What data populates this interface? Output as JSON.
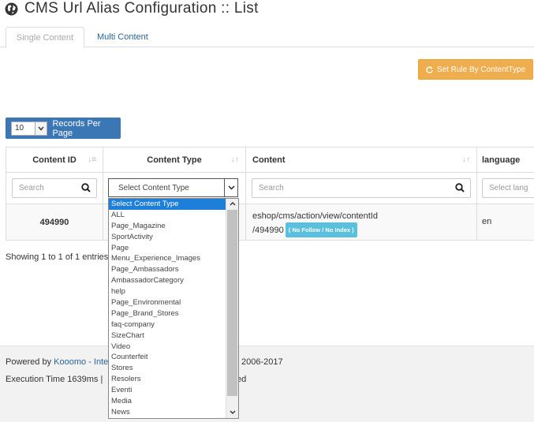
{
  "page": {
    "title": "CMS Url Alias Configuration :: List"
  },
  "tabs": [
    {
      "label": "Single Content",
      "active": true
    },
    {
      "label": "Multi Content",
      "active": false
    }
  ],
  "toolbar": {
    "rule_button_label": "Set Rule By ContentType"
  },
  "records_per_page": {
    "value": "10",
    "label": "Records Per Page"
  },
  "table": {
    "columns": [
      {
        "label": "Content ID"
      },
      {
        "label": "Content Type"
      },
      {
        "label": "Content"
      },
      {
        "label": "language"
      }
    ],
    "filters": {
      "content_id_placeholder": "Search",
      "content_type_value": "Select Content Type",
      "content_placeholder": "Search",
      "language_placeholder": "Select lang"
    },
    "rows": [
      {
        "content_id": "494990",
        "content_line1": "eshop/cms/action/view/contentId",
        "content_line2": "/494990",
        "badge": "( No Follow / No Index )",
        "language": "en"
      }
    ]
  },
  "info": {
    "text": "Showing 1 to 1 of 1 entries"
  },
  "content_type_dropdown": {
    "options": [
      "Select Content Type",
      "ALL",
      "Page_Magazine",
      "SportActivity",
      "Page",
      "Menu_Experience_Images",
      "Page_Ambassadors",
      "AmbassadorCategory",
      "help",
      "Page_Environmental",
      "Page_Brand_Stores",
      "faq-company",
      "SizeChart",
      "Video",
      "Counterfeit",
      "Stores",
      "Resolers",
      "Eventi",
      "Media",
      "News"
    ],
    "selected_index": 0
  },
  "footer": {
    "powered_prefix": "Powered by ",
    "powered_link": "Kooomo - Inte",
    "copyright": "2006-2017",
    "execution": "Execution Time 1639ms |",
    "execution_tail": "ed"
  },
  "colors": {
    "accent_blue": "#3a77b4",
    "rule_orange": "#f0ad4e",
    "badge_cyan": "#5bc0de",
    "dropdown_selected": "#1e7fd8"
  }
}
